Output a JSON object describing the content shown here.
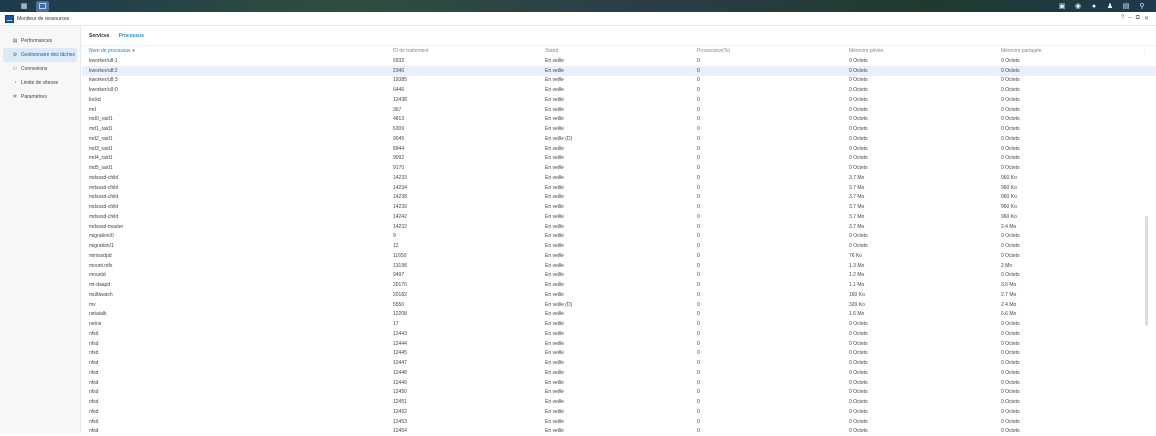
{
  "taskbar": {
    "main_icon": "grid-icon",
    "right_icons": [
      "widget-icon",
      "notification-icon",
      "chat-icon",
      "user-icon",
      "window-icon",
      "search-icon"
    ]
  },
  "window": {
    "title": "Moniteur de ressources",
    "help": "?",
    "minimize": "–",
    "restore": "⧉",
    "close": "✕"
  },
  "sidebar": {
    "items": [
      {
        "label": "Performances",
        "icon": "chart-icon"
      },
      {
        "label": "Gestionnaire des tâches",
        "icon": "task-icon",
        "active": true
      },
      {
        "label": "Connexions",
        "icon": "connections-icon"
      },
      {
        "label": "Limite de vitesse",
        "icon": "speed-icon"
      },
      {
        "label": "Paramètres",
        "icon": "settings-icon"
      }
    ]
  },
  "tabs": [
    {
      "label": "Services"
    },
    {
      "label": "Processus",
      "active": true
    }
  ],
  "table": {
    "columns": [
      "Nom de processus",
      "ID de traitement",
      "Statut",
      "Processeur(%)",
      "Mémoire privée",
      "Mémoire partagée"
    ],
    "sort_indicator": "▾",
    "rows": [
      [
        "kworker/u8:1",
        "6932",
        "En veille",
        "0",
        "0 Octets",
        "0 Octets"
      ],
      [
        "kworker/u8:2",
        "2340",
        "En veille",
        "0",
        "0 Octets",
        "0 Octets"
      ],
      [
        "kworker/u8:3",
        "19385",
        "En veille",
        "0",
        "0 Octets",
        "0 Octets"
      ],
      [
        "kworker/u9:0",
        "6446",
        "En veille",
        "0",
        "0 Octets",
        "0 Octets"
      ],
      [
        "lockd",
        "12438",
        "En veille",
        "0",
        "0 Octets",
        "0 Octets"
      ],
      [
        "md",
        "367",
        "En veille",
        "0",
        "0 Octets",
        "0 Octets"
      ],
      [
        "md0_raid1",
        "4813",
        "En veille",
        "0",
        "0 Octets",
        "0 Octets"
      ],
      [
        "md1_raid1",
        "6309",
        "En veille",
        "0",
        "0 Octets",
        "0 Octets"
      ],
      [
        "md2_raid1",
        "9045",
        "En veille (D)",
        "0",
        "0 Octets",
        "0 Octets"
      ],
      [
        "md3_raid1",
        "8944",
        "En veille",
        "0",
        "0 Octets",
        "0 Octets"
      ],
      [
        "md4_raid1",
        "9092",
        "En veille",
        "0",
        "0 Octets",
        "0 Octets"
      ],
      [
        "md5_raid1",
        "9170",
        "En veille",
        "0",
        "0 Octets",
        "0 Octets"
      ],
      [
        "mdsssd-child",
        "14233",
        "En veille",
        "0",
        "3.7 Mo",
        "960 Ko"
      ],
      [
        "mdsssd-child",
        "14234",
        "En veille",
        "0",
        "3.7 Mo",
        "960 Ko"
      ],
      [
        "mdsssd-child",
        "14238",
        "En veille",
        "0",
        "3.7 Mo",
        "960 Ko"
      ],
      [
        "mdsssd-child",
        "14239",
        "En veille",
        "0",
        "3.7 Mo",
        "960 Ko"
      ],
      [
        "mdsssd-child",
        "14242",
        "En veille",
        "0",
        "3.7 Mo",
        "960 Ko"
      ],
      [
        "mdsssd-master",
        "14232",
        "En veille",
        "0",
        "3.7 Mo",
        "2.4 Mo"
      ],
      [
        "migration/0",
        "9",
        "En veille",
        "0",
        "0 Octets",
        "0 Octets"
      ],
      [
        "migration/1",
        "12",
        "En veille",
        "0",
        "0 Octets",
        "0 Octets"
      ],
      [
        "minissdpd",
        "11650",
        "En veille",
        "0",
        "76 Ko",
        "0 Octets"
      ],
      [
        "mount.ntfs",
        "13198",
        "En veille",
        "0",
        "1.3 Mo",
        "2 Mo"
      ],
      [
        "mountd",
        "9497",
        "En veille",
        "0",
        "1.2 Mo",
        "0 Octets"
      ],
      [
        "mt-daapd",
        "20170",
        "En veille",
        "0",
        "1.1 Mo",
        "3.6 Mo"
      ],
      [
        "multiwatch",
        "20182",
        "En veille",
        "0",
        "160 Ko",
        "2.7 Mo"
      ],
      [
        "mv",
        "5550",
        "En veille (D)",
        "0",
        "320 Ko",
        "2.4 Mo"
      ],
      [
        "netatalk",
        "12208",
        "En veille",
        "0",
        "1.6 Mo",
        "6.6 Mo"
      ],
      [
        "netns",
        "17",
        "En veille",
        "0",
        "0 Octets",
        "0 Octets"
      ],
      [
        "nfsd",
        "12443",
        "En veille",
        "0",
        "0 Octets",
        "0 Octets"
      ],
      [
        "nfsd",
        "12444",
        "En veille",
        "0",
        "0 Octets",
        "0 Octets"
      ],
      [
        "nfsd",
        "12445",
        "En veille",
        "0",
        "0 Octets",
        "0 Octets"
      ],
      [
        "nfsd",
        "12447",
        "En veille",
        "0",
        "0 Octets",
        "0 Octets"
      ],
      [
        "nfsd",
        "12448",
        "En veille",
        "0",
        "0 Octets",
        "0 Octets"
      ],
      [
        "nfsd",
        "12449",
        "En veille",
        "0",
        "0 Octets",
        "0 Octets"
      ],
      [
        "nfsd",
        "12450",
        "En veille",
        "0",
        "0 Octets",
        "0 Octets"
      ],
      [
        "nfsd",
        "12451",
        "En veille",
        "0",
        "0 Octets",
        "0 Octets"
      ],
      [
        "nfsd",
        "12452",
        "En veille",
        "0",
        "0 Octets",
        "0 Octets"
      ],
      [
        "nfsd",
        "12453",
        "En veille",
        "0",
        "0 Octets",
        "0 Octets"
      ],
      [
        "nfsd",
        "12454",
        "En veille",
        "0",
        "0 Octets",
        "0 Octets"
      ]
    ],
    "selected_row": 1
  }
}
